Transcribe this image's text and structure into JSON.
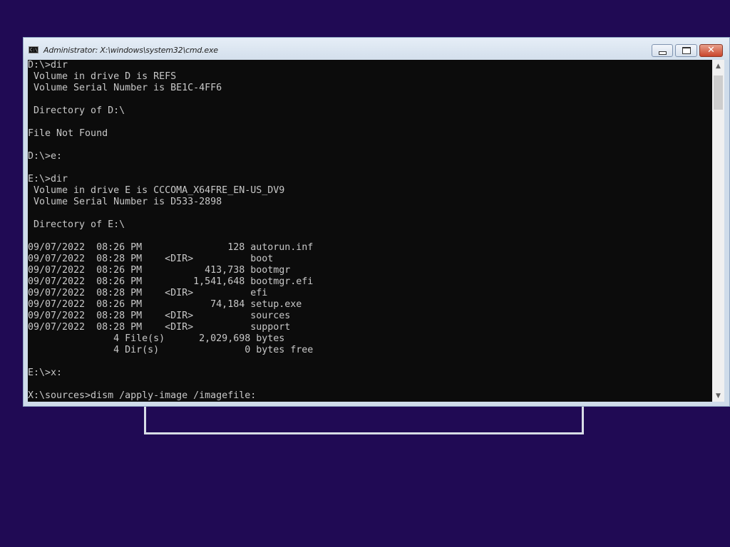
{
  "window": {
    "title": "Administrator: X:\\windows\\system32\\cmd.exe",
    "icon": "cmd-icon",
    "icon_text": "C:\\",
    "buttons": {
      "minimize": "minimize-icon",
      "maximize": "maximize-icon",
      "close": "✕"
    }
  },
  "console": {
    "lines": [
      "D:\\>dir",
      " Volume in drive D is REFS",
      " Volume Serial Number is BE1C-4FF6",
      "",
      " Directory of D:\\",
      "",
      "File Not Found",
      "",
      "D:\\>e:",
      "",
      "E:\\>dir",
      " Volume in drive E is CCCOMA_X64FRE_EN-US_DV9",
      " Volume Serial Number is D533-2898",
      "",
      " Directory of E:\\",
      "",
      "09/07/2022  08:26 PM               128 autorun.inf",
      "09/07/2022  08:28 PM    <DIR>          boot",
      "09/07/2022  08:26 PM           413,738 bootmgr",
      "09/07/2022  08:26 PM         1,541,648 bootmgr.efi",
      "09/07/2022  08:28 PM    <DIR>          efi",
      "09/07/2022  08:26 PM            74,184 setup.exe",
      "09/07/2022  08:28 PM    <DIR>          sources",
      "09/07/2022  08:28 PM    <DIR>          support",
      "               4 File(s)      2,029,698 bytes",
      "               4 Dir(s)               0 bytes free",
      "",
      "E:\\>x:",
      "",
      "X:\\sources>dism /apply-image /imagefile:"
    ]
  },
  "scrollbar": {
    "up_icon": "▲",
    "down_icon": "▼"
  },
  "colors": {
    "desktop": "#200a54",
    "console_bg": "#0c0c0c",
    "console_text": "#c8c8c8",
    "frame": "#cfdcea"
  }
}
